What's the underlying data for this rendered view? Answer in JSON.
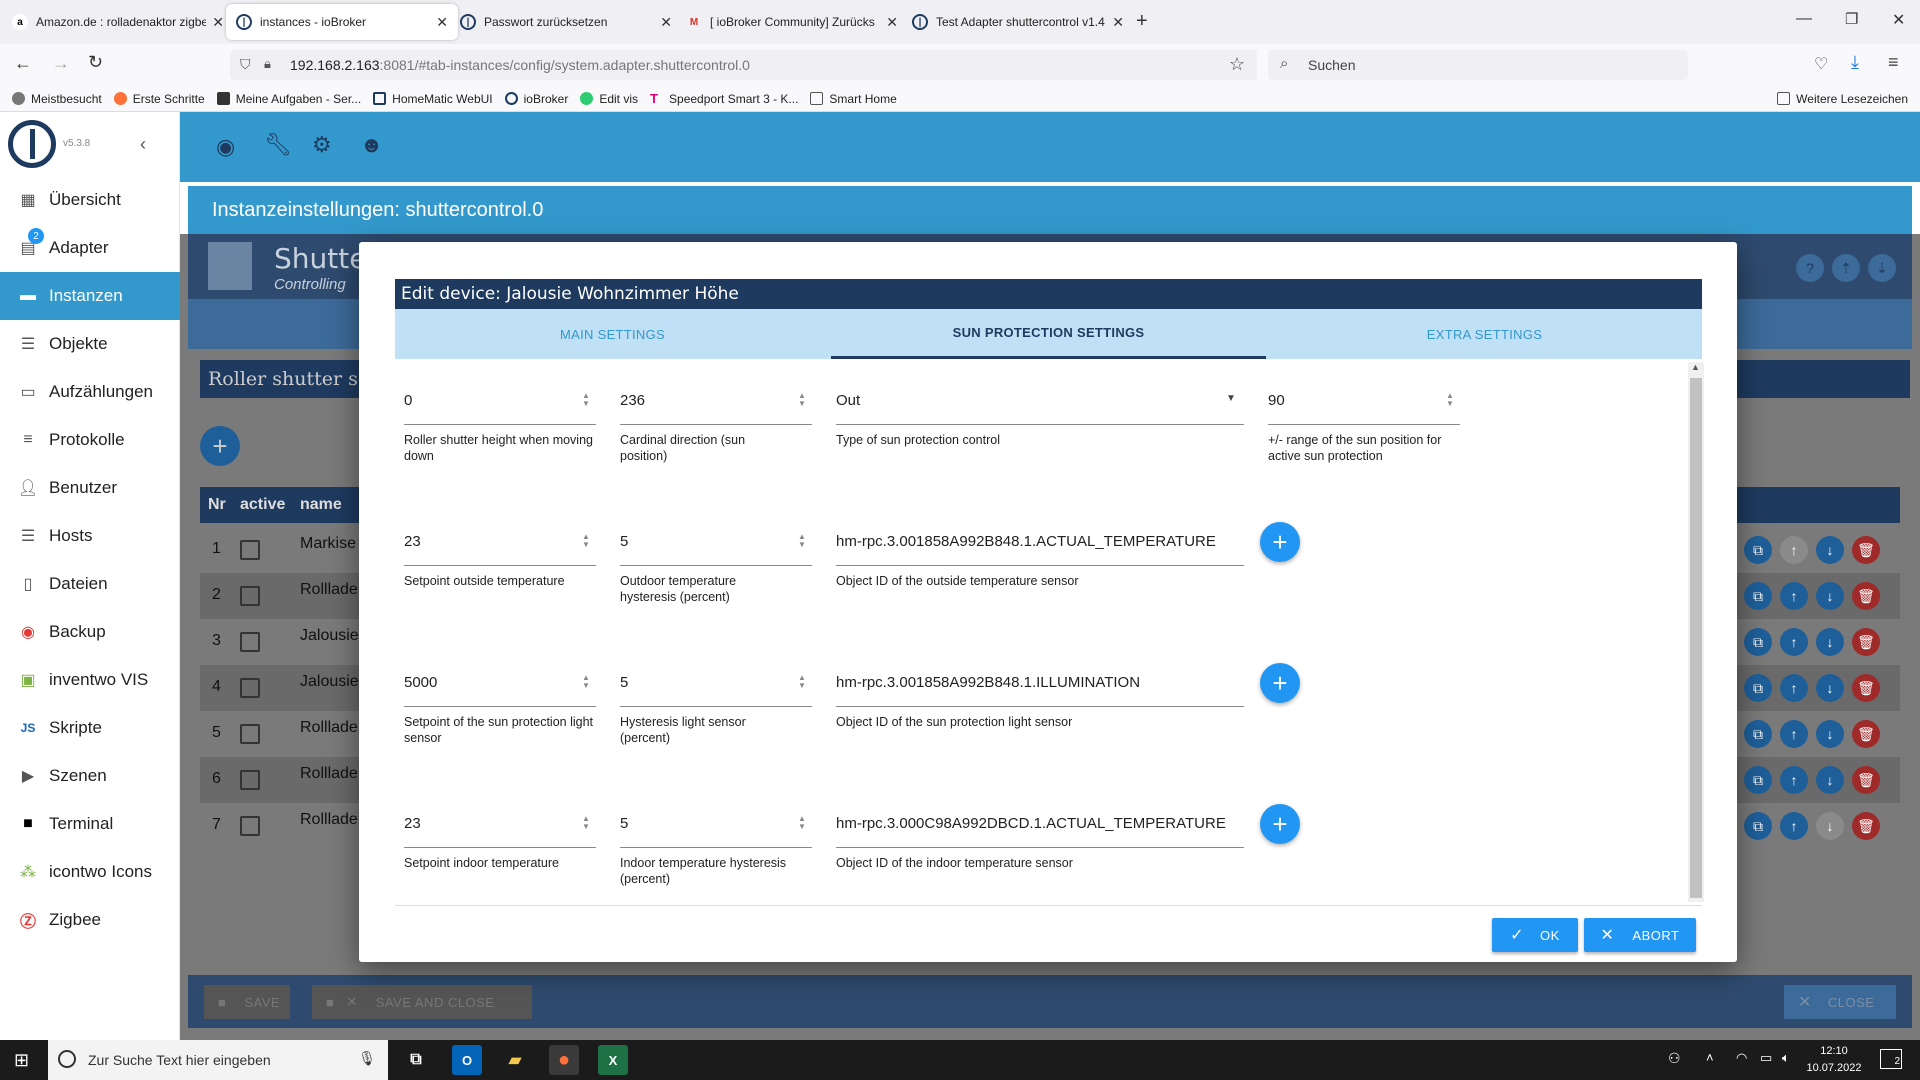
{
  "browser": {
    "tabs": [
      {
        "title": "Amazon.de : rolladenaktor zigbee",
        "icon": "amazon-icon"
      },
      {
        "title": "instances - ioBroker",
        "icon": "iobroker-icon"
      },
      {
        "title": "Passwort zurücksetzen",
        "icon": "iobroker-icon"
      },
      {
        "title": "[ ioBroker Community] Zurücks",
        "icon": "gmail-icon"
      },
      {
        "title": "Test Adapter shuttercontrol v1.4",
        "icon": "iobroker-icon"
      }
    ],
    "url_host": "192.168.2.163",
    "url_rest": ":8081/#tab-instances/config/system.adapter.shuttercontrol.0",
    "search_placeholder": "Suchen",
    "bookmarks": [
      "Meistbesucht",
      "Erste Schritte",
      "Meine Aufgaben - Ser...",
      "HomeMatic WebUI",
      "ioBroker",
      "Edit vis",
      "Speedport Smart 3 - K...",
      "Smart Home"
    ],
    "other_bookmarks": "Weitere Lesezeichen"
  },
  "app": {
    "version": "v5.3.8",
    "sidebar": [
      {
        "label": "Übersicht",
        "icon": "grid-icon"
      },
      {
        "label": "Adapter",
        "icon": "store-icon",
        "badge": "2"
      },
      {
        "label": "Instanzen",
        "icon": "instances-icon"
      },
      {
        "label": "Objekte",
        "icon": "list-icon"
      },
      {
        "label": "Aufzählungen",
        "icon": "enum-icon"
      },
      {
        "label": "Protokolle",
        "icon": "log-icon"
      },
      {
        "label": "Benutzer",
        "icon": "user-icon"
      },
      {
        "label": "Hosts",
        "icon": "hosts-icon"
      },
      {
        "label": "Dateien",
        "icon": "file-icon"
      },
      {
        "label": "Backup",
        "icon": "backup-icon"
      },
      {
        "label": "inventwo VIS",
        "icon": "vis-icon"
      },
      {
        "label": "Skripte",
        "icon": "js-icon"
      },
      {
        "label": "Szenen",
        "icon": "scenes-icon"
      },
      {
        "label": "Terminal",
        "icon": "terminal-icon"
      },
      {
        "label": "icontwo Icons",
        "icon": "icons-icon"
      },
      {
        "label": "Zigbee",
        "icon": "zigbee-icon"
      }
    ],
    "instance_title": "Instanzeinstellungen: shuttercontrol.0",
    "adapter_title": "Shutte",
    "adapter_subtitle": "Controlling",
    "section_title": "Roller shutter se",
    "table_headers": {
      "nr": "Nr",
      "active": "active",
      "name": "name"
    },
    "rows": [
      {
        "nr": "1",
        "name": "Markise"
      },
      {
        "nr": "2",
        "name": "Rollladen"
      },
      {
        "nr": "3",
        "name": "Jalousie"
      },
      {
        "nr": "4",
        "name": "Jalousie"
      },
      {
        "nr": "5",
        "name": "Rollladen"
      },
      {
        "nr": "6",
        "name": "Rollladen"
      },
      {
        "nr": "7",
        "name": "Rollladen"
      }
    ],
    "footer": {
      "save": "SAVE",
      "save_close": "SAVE AND CLOSE",
      "close": "CLOSE"
    }
  },
  "dialog": {
    "title": "Edit device: Jalousie Wohnzimmer Höhe",
    "tabs": [
      "MAIN SETTINGS",
      "SUN PROTECTION SETTINGS",
      "EXTRA SETTINGS"
    ],
    "active_tab": "SUN PROTECTION SETTINGS",
    "fields": {
      "height_down": {
        "value": "0",
        "label": "Roller shutter height when moving down"
      },
      "cardinal": {
        "value": "236",
        "label": "Cardinal direction (sun position)"
      },
      "sun_type": {
        "value": "Out",
        "label": "Type of sun protection control"
      },
      "range": {
        "value": "90",
        "label": "+/- range of the sun position for active sun protection"
      },
      "setpoint_outside": {
        "value": "23",
        "label": "Setpoint outside temperature"
      },
      "outdoor_hyst": {
        "value": "5",
        "label": "Outdoor temperature hysteresis (percent)"
      },
      "outside_sensor": {
        "value": "hm-rpc.3.001858A992B848.1.ACTUAL_TEMPERATURE",
        "label": "Object ID of the outside temperature sensor"
      },
      "setpoint_light": {
        "value": "5000",
        "label": "Setpoint of the sun protection light sensor"
      },
      "light_hyst": {
        "value": "5",
        "label": "Hysteresis light sensor (percent)"
      },
      "light_sensor": {
        "value": "hm-rpc.3.001858A992B848.1.ILLUMINATION",
        "label": "Object ID of the sun protection light sensor"
      },
      "setpoint_indoor": {
        "value": "23",
        "label": "Setpoint indoor temperature"
      },
      "indoor_hyst": {
        "value": "5",
        "label": "Indoor temperature hysteresis (percent)"
      },
      "indoor_sensor": {
        "value": "hm-rpc.3.000C98A992DBCD.1.ACTUAL_TEMPERATURE",
        "label": "Object ID of the indoor temperature sensor"
      }
    },
    "ok": "OK",
    "abort": "ABORT"
  },
  "taskbar": {
    "search_placeholder": "Zur Suche Text hier eingeben",
    "time": "12:10",
    "date": "10.07.2022",
    "notifications": "2"
  },
  "colors": {
    "accent": "#3399cc",
    "dark": "#1e3a5f",
    "button": "#2196f3",
    "delete": "#d32f2f"
  }
}
